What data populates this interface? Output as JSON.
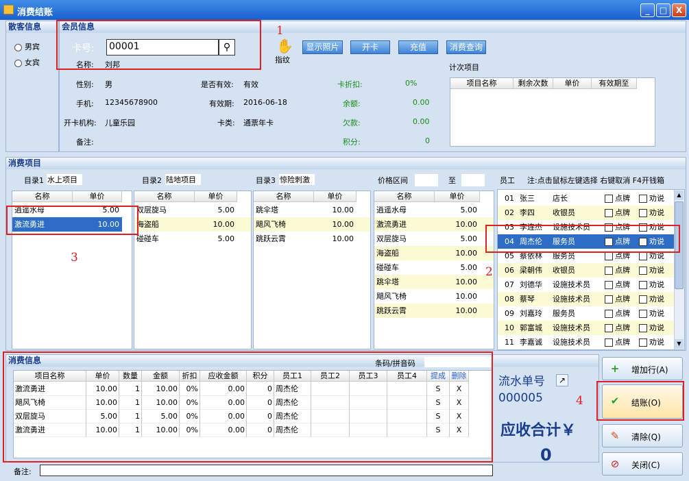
{
  "window": {
    "title": "消费结账",
    "btn_min": "_",
    "btn_max": "□",
    "btn_close": "X"
  },
  "guest": {
    "header": "散客信息",
    "male": "男宾",
    "female": "女宾"
  },
  "member": {
    "header": "会员信息",
    "card_label": "卡号:",
    "card_value": "00001",
    "name_label": "名称:",
    "name_value": "刘邦",
    "fingerprint": "指纹",
    "btn_photo": "显示照片",
    "btn_open": "开卡",
    "btn_recharge": "充值",
    "btn_query": "消费查询",
    "count_title": "计次项目",
    "count_cols": [
      "项目名称",
      "剩余次数",
      "单价",
      "有效期至"
    ],
    "gender_label": "性别:",
    "gender_value": "男",
    "valid_label": "是否有效:",
    "valid_value": "有效",
    "discount_label": "卡折扣:",
    "discount_value": "0%",
    "phone_label": "手机:",
    "phone_value": "12345678900",
    "expire_label": "有效期:",
    "expire_value": "2016-06-18",
    "balance_label": "余额:",
    "balance_value": "0.00",
    "org_label": "开卡机构:",
    "org_value": "儿童乐园",
    "type_label": "卡类:",
    "type_value": "通票年卡",
    "debt_label": "欠款:",
    "debt_value": "0.00",
    "note_label": "备注:",
    "points_label": "积分:",
    "points_value": "0"
  },
  "items": {
    "header": "消费项目",
    "cat1": {
      "label": "目录1",
      "name": "水上项目",
      "cols": [
        "名称",
        "单价"
      ],
      "rows": [
        [
          "逍遥水母",
          "5.00"
        ],
        [
          "激流勇进",
          "10.00"
        ]
      ]
    },
    "cat2": {
      "label": "目录2",
      "name": "陆地项目",
      "cols": [
        "名称",
        "单价"
      ],
      "rows": [
        [
          "双层旋马",
          "5.00"
        ],
        [
          "海盗船",
          "10.00"
        ],
        [
          "碰碰车",
          "5.00"
        ]
      ]
    },
    "cat3": {
      "label": "目录3",
      "name": "惊险刺激",
      "cols": [
        "名称",
        "单价"
      ],
      "rows": [
        [
          "跳伞塔",
          "10.00"
        ],
        [
          "飓风飞椅",
          "10.00"
        ],
        [
          "跳跃云霄",
          "10.00"
        ]
      ]
    },
    "price": {
      "label": "价格区间",
      "to": "至",
      "cols": [
        "名称",
        "单价"
      ],
      "rows": [
        [
          "逍遥水母",
          "5.00"
        ],
        [
          "激流勇进",
          "10.00"
        ],
        [
          "双层旋马",
          "5.00"
        ],
        [
          "海盗船",
          "10.00"
        ],
        [
          "碰碰车",
          "5.00"
        ],
        [
          "跳伞塔",
          "10.00"
        ],
        [
          "飓风飞椅",
          "10.00"
        ],
        [
          "跳跃云霄",
          "10.00"
        ]
      ]
    },
    "staff": {
      "label": "员工",
      "note": "注:点击鼠标左键选择 右键取消 F4开钱箱",
      "check1": "点牌",
      "check2": "劝说",
      "rows": [
        [
          "01",
          "张三",
          "店长"
        ],
        [
          "02",
          "李四",
          "收银员"
        ],
        [
          "03",
          "李连杰",
          "设施技术员"
        ],
        [
          "04",
          "周杰伦",
          "服务员"
        ],
        [
          "05",
          "蔡依林",
          "服务员"
        ],
        [
          "06",
          "梁朝伟",
          "收银员"
        ],
        [
          "07",
          "刘德华",
          "设施技术员"
        ],
        [
          "08",
          "蔡琴",
          "设施技术员"
        ],
        [
          "09",
          "刘嘉玲",
          "服务员"
        ],
        [
          "10",
          "郭富城",
          "设施技术员"
        ],
        [
          "11",
          "李嘉诚",
          "设施技术员"
        ]
      ]
    }
  },
  "consume": {
    "header": "消费信息",
    "barcode_label": "条码/拼音码",
    "cols": [
      "项目名称",
      "单价",
      "数量",
      "金额",
      "折扣",
      "应收金额",
      "积分",
      "员工1",
      "员工2",
      "员工3",
      "员工4",
      "提成",
      "删除"
    ],
    "rows": [
      [
        "激流勇进",
        "10.00",
        "1",
        "10.00",
        "0%",
        "0.00",
        "0",
        "周杰伦",
        "",
        "",
        "",
        "S",
        "X"
      ],
      [
        "飓风飞椅",
        "10.00",
        "1",
        "10.00",
        "0%",
        "0.00",
        "0",
        "周杰伦",
        "",
        "",
        "",
        "S",
        "X"
      ],
      [
        "双层旋马",
        "5.00",
        "1",
        "5.00",
        "0%",
        "0.00",
        "0",
        "周杰伦",
        "",
        "",
        "",
        "S",
        "X"
      ],
      [
        "激流勇进",
        "10.00",
        "1",
        "10.00",
        "0%",
        "0.00",
        "0",
        "周杰伦",
        "",
        "",
        "",
        "S",
        "X"
      ]
    ],
    "note_label": "备注:"
  },
  "summary": {
    "serial_label": "流水单号",
    "serial_value": "000005",
    "total_label": "应收合计￥",
    "total_value": "0"
  },
  "actions": {
    "add": "增加行(A)",
    "checkout": "结账(O)",
    "clear": "清除(Q)",
    "close": "关闭(C)"
  },
  "annotations": [
    "1",
    "2",
    "3",
    "4"
  ]
}
